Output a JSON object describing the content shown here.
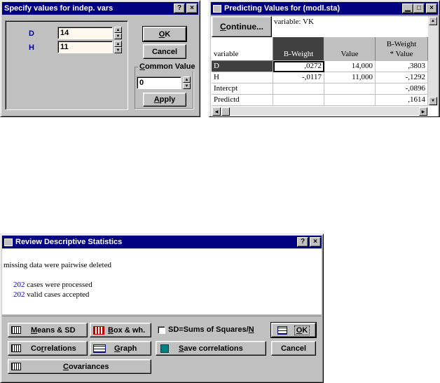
{
  "dialog1": {
    "title": "Specify values for indep. vars",
    "help": "?",
    "close": "×",
    "vars": [
      {
        "label": "D",
        "value": "14"
      },
      {
        "label": "H",
        "value": "11"
      }
    ],
    "ok_prefix": "",
    "ok_ul": "O",
    "ok_rest": "K",
    "cancel": "Cancel",
    "common_ul": "C",
    "common_rest": "ommon Value",
    "common_value": "0",
    "apply_ul": "A",
    "apply_rest": "pply"
  },
  "dialog2": {
    "title": "Predicting Values for (modl.sta)",
    "minimize": "▁",
    "maximize": "□",
    "close": "×",
    "continue_ul": "C",
    "continue_rest": "ontinue...",
    "variable_note": "variable: VK",
    "headers": [
      "variable",
      "B-Weight",
      "Value",
      "B-Weight\n* Value"
    ],
    "rows": [
      {
        "name": "D",
        "bw": ",0272",
        "val": "14,000",
        "bwv": ",3803"
      },
      {
        "name": "H",
        "bw": "-,0117",
        "val": "11,000",
        "bwv": "-,1292"
      },
      {
        "name": "Intercpt",
        "bw": "",
        "val": "",
        "bwv": "-,0896"
      },
      {
        "name": "Predictd",
        "bw": "",
        "val": "",
        "bwv": ",1614"
      }
    ]
  },
  "dialog3": {
    "title": "Review Descriptive Statistics",
    "help": "?",
    "close": "×",
    "line1": "missing data were pairwise deleted",
    "cases1_num": "202",
    "cases1_text": " cases were processed",
    "cases2_num": "202",
    "cases2_text": " valid cases accepted",
    "means_ul": "M",
    "means_rest": "eans & SD",
    "box_ul": "B",
    "box_rest": "ox & wh.",
    "checkbox_label": "SD=Sums of Squares/",
    "checkbox_ul": "N",
    "ok_ul": "O",
    "ok_rest": "K",
    "corr_pre": "Co",
    "corr_ul": "r",
    "corr_rest": "relations",
    "graph_ul": "G",
    "graph_rest": "raph",
    "save_ul": "S",
    "save_rest": "ave correlations",
    "cancel": "Cancel",
    "cov_ul": "C",
    "cov_rest": "ovariances"
  }
}
